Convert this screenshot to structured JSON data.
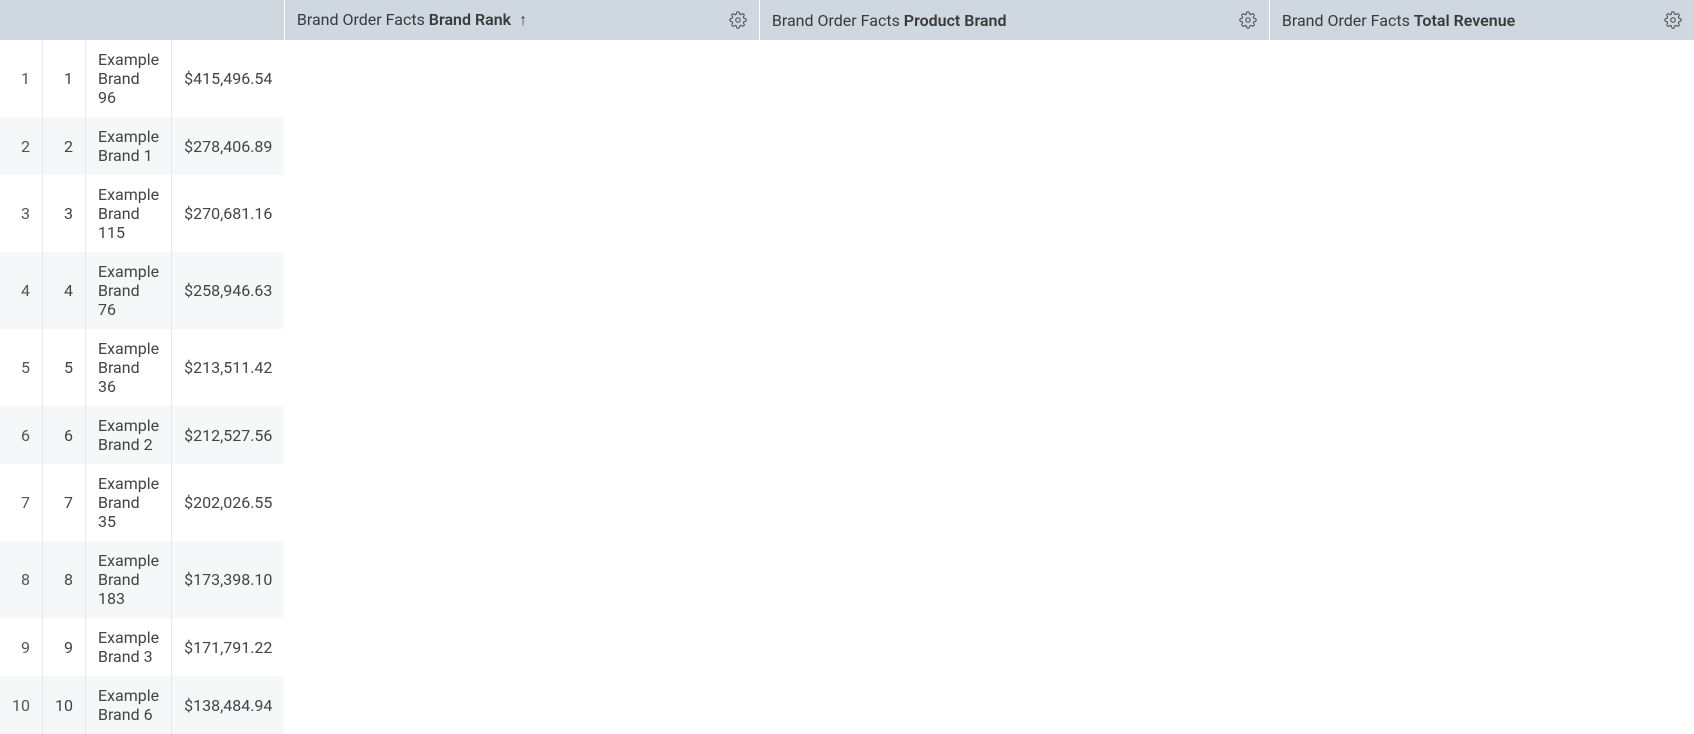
{
  "table": {
    "header_prefix": "Brand Order Facts",
    "sort_arrow": "↑",
    "columns": [
      {
        "label": "Brand Rank",
        "sorted": true
      },
      {
        "label": "Product Brand",
        "sorted": false
      },
      {
        "label": "Total Revenue",
        "sorted": false
      }
    ],
    "rows": [
      {
        "n": "1",
        "rank": "1",
        "brand": "Example Brand 96",
        "revenue": "$415,496.54"
      },
      {
        "n": "2",
        "rank": "2",
        "brand": "Example Brand 1",
        "revenue": "$278,406.89"
      },
      {
        "n": "3",
        "rank": "3",
        "brand": "Example Brand 115",
        "revenue": "$270,681.16"
      },
      {
        "n": "4",
        "rank": "4",
        "brand": "Example Brand 76",
        "revenue": "$258,946.63"
      },
      {
        "n": "5",
        "rank": "5",
        "brand": "Example Brand 36",
        "revenue": "$213,511.42"
      },
      {
        "n": "6",
        "rank": "6",
        "brand": "Example Brand 2",
        "revenue": "$212,527.56"
      },
      {
        "n": "7",
        "rank": "7",
        "brand": "Example Brand 35",
        "revenue": "$202,026.55"
      },
      {
        "n": "8",
        "rank": "8",
        "brand": "Example Brand 183",
        "revenue": "$173,398.10"
      },
      {
        "n": "9",
        "rank": "9",
        "brand": "Example Brand 3",
        "revenue": "$171,791.22"
      },
      {
        "n": "10",
        "rank": "10",
        "brand": "Example Brand 6",
        "revenue": "$138,484.94"
      }
    ]
  }
}
